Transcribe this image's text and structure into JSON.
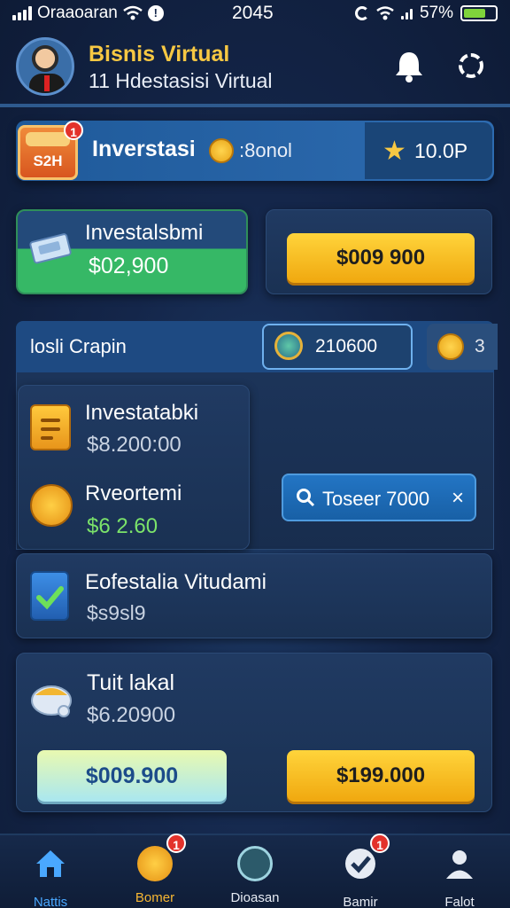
{
  "status_bar": {
    "carrier": "Oraaoaran",
    "time": "2045",
    "battery": "57%"
  },
  "header": {
    "title": "Bisnis Virtual",
    "subtitle": "11 Hdestasisi Virtual",
    "icons": [
      "bell-icon",
      "settings-icon"
    ]
  },
  "banner": {
    "chest_label": "S2H",
    "chest_badge": "1",
    "label": "Inverstasi",
    "value": ":8onol",
    "right_value": "10.0P"
  },
  "card_green": {
    "title": "Investalsbmi",
    "value": "$02,900"
  },
  "card_right": {
    "button_label": "$009 900"
  },
  "tabs": {
    "label": "losli Crapin",
    "chip_value": "210600",
    "chip2_value": "3"
  },
  "list": {
    "item1_title": "Investatabki",
    "item1_value": "$8.200:00",
    "item2_title": "Rveortemi",
    "item2_value": "$6 2.60",
    "search_pill": "Toseer 7000",
    "item3_title": "Eofestalia Vitudami",
    "item3_value": "$s9sl9"
  },
  "bottom_card": {
    "title": "Tuit lakal",
    "value": "$6.20900",
    "button_left": "$009.900",
    "button_right": "$199.000"
  },
  "nav": {
    "items": [
      {
        "label": "Nattis",
        "icon": "home-icon",
        "color": "#4aa8ff"
      },
      {
        "label": "Bomer",
        "icon": "coin-icon",
        "color": "#f7b733",
        "badge": "1"
      },
      {
        "label": "Dioasan",
        "icon": "mask-icon",
        "color": "#e6ebf3"
      },
      {
        "label": "Bamir",
        "icon": "check-icon",
        "color": "#e6ebf3",
        "badge": "1"
      },
      {
        "label": "Falot",
        "icon": "user-icon",
        "color": "#e6ebf3"
      }
    ]
  },
  "colors": {
    "accent_gold": "#f7c843",
    "background": "#14264a",
    "green": "#36b866",
    "badge_red": "#e3322b"
  }
}
